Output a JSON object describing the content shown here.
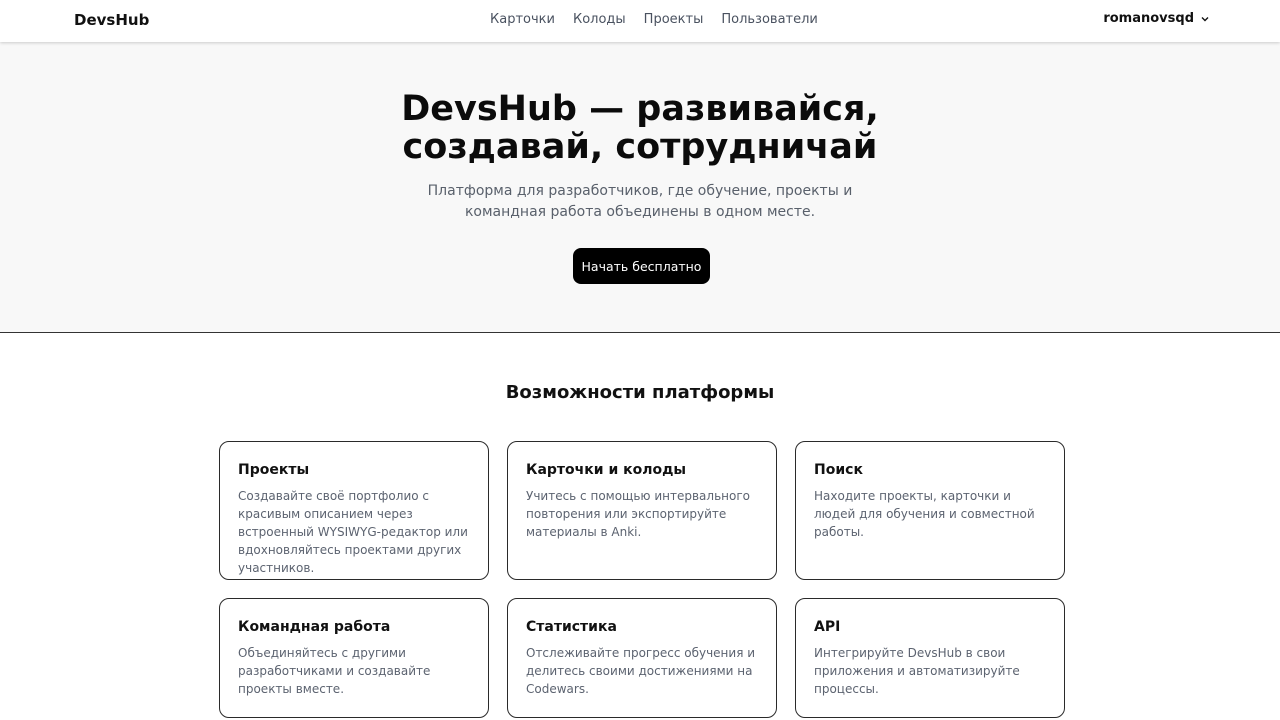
{
  "navbar": {
    "brand": "DevsHub",
    "links": [
      "Карточки",
      "Колоды",
      "Проекты",
      "Пользователи"
    ],
    "user": "romanovsqd",
    "user_icon": "chevron-down-icon"
  },
  "hero": {
    "title_line1": "DevsHub — развивайся,",
    "title_line2": "создавай, сотрудничай",
    "subtitle": "Платформа для разработчиков, где обучение, проекты и командная работа объединены в одном месте.",
    "cta": "Начать бесплатно"
  },
  "features": {
    "title": "Возможности платформы",
    "cards": [
      {
        "title": "Проекты",
        "text": "Создавайте своё портфолио с красивым описанием через встроенный WYSIWYG-редактор или вдохновляйтесь проектами других участников."
      },
      {
        "title": "Карточки и колоды",
        "text": "Учитесь с помощью интервального повторения или экспортируйте материалы в Anki."
      },
      {
        "title": "Поиск",
        "text": "Находите проекты, карточки и людей для обучения и совместной работы."
      },
      {
        "title": "Командная работа",
        "text": "Объединяйтесь с другими разработчиками и создавайте проекты вместе."
      },
      {
        "title": "Статистика",
        "text": "Отслеживайте прогресс обучения и делитесь своими достижениями на Codewars."
      },
      {
        "title": "API",
        "text": "Интегрируйте DevsHub в свои приложения и автоматизируйте процессы."
      }
    ]
  },
  "colors": {
    "primary_button": "#000000",
    "hero_background": "#f8f8f8",
    "muted_text": "#59606b"
  }
}
